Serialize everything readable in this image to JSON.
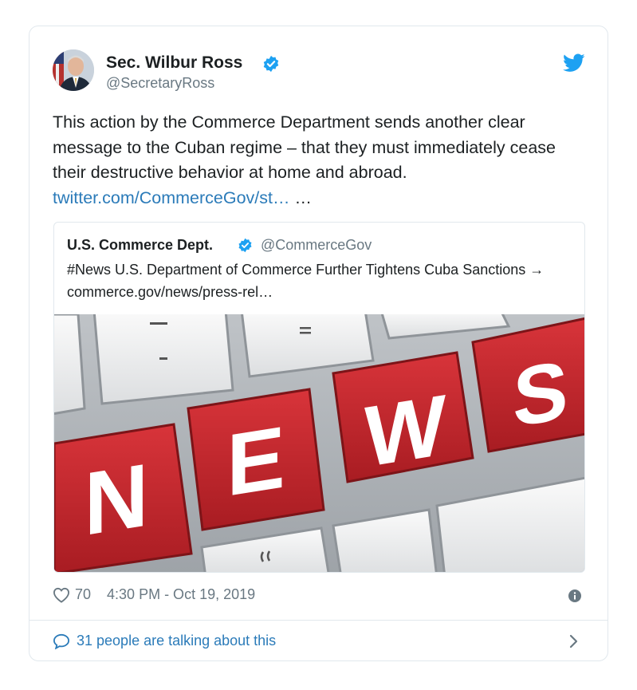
{
  "author": {
    "name": "Sec. Wilbur Ross",
    "handle": "@SecretaryRoss"
  },
  "tweet": {
    "text": "This action by the Commerce Department sends another clear message to the Cuban regime – that they must immediately cease their destructive behavior at home and abroad.",
    "link": "twitter.com/CommerceGov/st…",
    "ellipsis": "…"
  },
  "quoted": {
    "name": "U.S. Commerce Dept.",
    "handle": "@CommerceGov",
    "text": "#News U.S. Department of Commerce Further Tightens Cuba Sanctions → commerce.gov/news/press-rel…",
    "image_letters": [
      "N",
      "E",
      "W",
      "S"
    ]
  },
  "footer": {
    "likes": "70",
    "timestamp": "4:30 PM - Oct 19, 2019",
    "talking": "31 people are talking about this"
  },
  "colors": {
    "twitter_blue": "#1da1f2",
    "link": "#2b7bb9",
    "muted": "#697882",
    "key_red": "#c8262b"
  },
  "icons": [
    "verified-badge-icon",
    "twitter-bird-icon",
    "heart-icon",
    "info-icon",
    "speech-bubble-icon",
    "chevron-right-icon"
  ]
}
